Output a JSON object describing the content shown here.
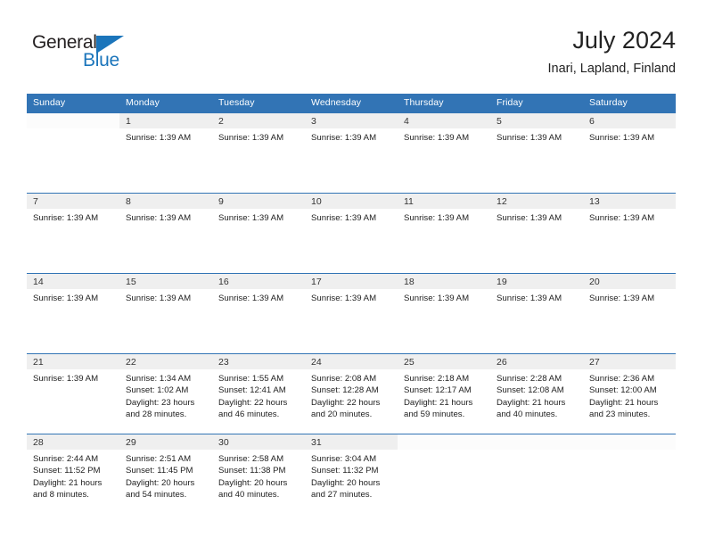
{
  "brand": {
    "name_dark": "General",
    "name_blue": "Blue",
    "color_blue": "#1b75bb"
  },
  "header": {
    "title": "July 2024",
    "subtitle": "Inari, Lapland, Finland"
  },
  "theme": {
    "header_blue": "#3274b5",
    "day_band_gray": "#efefef"
  },
  "weekdays": [
    "Sunday",
    "Monday",
    "Tuesday",
    "Wednesday",
    "Thursday",
    "Friday",
    "Saturday"
  ],
  "weeks": [
    [
      {
        "day": "",
        "lines": []
      },
      {
        "day": "1",
        "lines": [
          "Sunrise: 1:39 AM"
        ]
      },
      {
        "day": "2",
        "lines": [
          "Sunrise: 1:39 AM"
        ]
      },
      {
        "day": "3",
        "lines": [
          "Sunrise: 1:39 AM"
        ]
      },
      {
        "day": "4",
        "lines": [
          "Sunrise: 1:39 AM"
        ]
      },
      {
        "day": "5",
        "lines": [
          "Sunrise: 1:39 AM"
        ]
      },
      {
        "day": "6",
        "lines": [
          "Sunrise: 1:39 AM"
        ]
      }
    ],
    [
      {
        "day": "7",
        "lines": [
          "Sunrise: 1:39 AM"
        ]
      },
      {
        "day": "8",
        "lines": [
          "Sunrise: 1:39 AM"
        ]
      },
      {
        "day": "9",
        "lines": [
          "Sunrise: 1:39 AM"
        ]
      },
      {
        "day": "10",
        "lines": [
          "Sunrise: 1:39 AM"
        ]
      },
      {
        "day": "11",
        "lines": [
          "Sunrise: 1:39 AM"
        ]
      },
      {
        "day": "12",
        "lines": [
          "Sunrise: 1:39 AM"
        ]
      },
      {
        "day": "13",
        "lines": [
          "Sunrise: 1:39 AM"
        ]
      }
    ],
    [
      {
        "day": "14",
        "lines": [
          "Sunrise: 1:39 AM"
        ]
      },
      {
        "day": "15",
        "lines": [
          "Sunrise: 1:39 AM"
        ]
      },
      {
        "day": "16",
        "lines": [
          "Sunrise: 1:39 AM"
        ]
      },
      {
        "day": "17",
        "lines": [
          "Sunrise: 1:39 AM"
        ]
      },
      {
        "day": "18",
        "lines": [
          "Sunrise: 1:39 AM"
        ]
      },
      {
        "day": "19",
        "lines": [
          "Sunrise: 1:39 AM"
        ]
      },
      {
        "day": "20",
        "lines": [
          "Sunrise: 1:39 AM"
        ]
      }
    ],
    [
      {
        "day": "21",
        "lines": [
          "Sunrise: 1:39 AM"
        ]
      },
      {
        "day": "22",
        "lines": [
          "Sunrise: 1:34 AM",
          "Sunset: 1:02 AM",
          "Daylight: 23 hours and 28 minutes."
        ]
      },
      {
        "day": "23",
        "lines": [
          "Sunrise: 1:55 AM",
          "Sunset: 12:41 AM",
          "Daylight: 22 hours and 46 minutes."
        ]
      },
      {
        "day": "24",
        "lines": [
          "Sunrise: 2:08 AM",
          "Sunset: 12:28 AM",
          "Daylight: 22 hours and 20 minutes."
        ]
      },
      {
        "day": "25",
        "lines": [
          "Sunrise: 2:18 AM",
          "Sunset: 12:17 AM",
          "Daylight: 21 hours and 59 minutes."
        ]
      },
      {
        "day": "26",
        "lines": [
          "Sunrise: 2:28 AM",
          "Sunset: 12:08 AM",
          "Daylight: 21 hours and 40 minutes."
        ]
      },
      {
        "day": "27",
        "lines": [
          "Sunrise: 2:36 AM",
          "Sunset: 12:00 AM",
          "Daylight: 21 hours and 23 minutes."
        ]
      }
    ],
    [
      {
        "day": "28",
        "lines": [
          "Sunrise: 2:44 AM",
          "Sunset: 11:52 PM",
          "Daylight: 21 hours and 8 minutes."
        ]
      },
      {
        "day": "29",
        "lines": [
          "Sunrise: 2:51 AM",
          "Sunset: 11:45 PM",
          "Daylight: 20 hours and 54 minutes."
        ]
      },
      {
        "day": "30",
        "lines": [
          "Sunrise: 2:58 AM",
          "Sunset: 11:38 PM",
          "Daylight: 20 hours and 40 minutes."
        ]
      },
      {
        "day": "31",
        "lines": [
          "Sunrise: 3:04 AM",
          "Sunset: 11:32 PM",
          "Daylight: 20 hours and 27 minutes."
        ]
      },
      {
        "day": "",
        "lines": []
      },
      {
        "day": "",
        "lines": []
      },
      {
        "day": "",
        "lines": []
      }
    ]
  ]
}
